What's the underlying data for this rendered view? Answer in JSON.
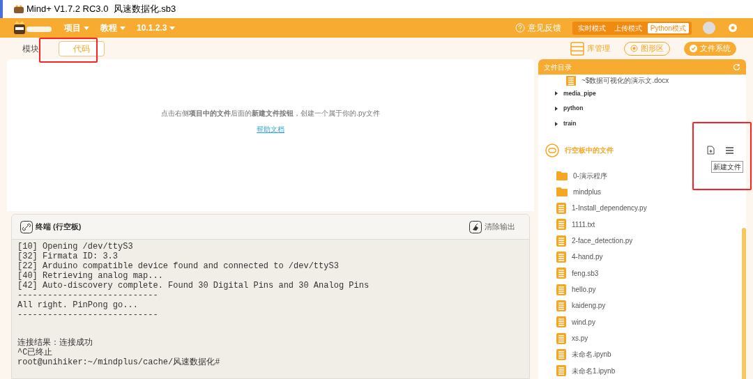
{
  "window": {
    "title": "Mind+ V1.7.2 RC3.0  风速数据化.sb3"
  },
  "menu": [
    {
      "label": "项目"
    },
    {
      "label": "教程"
    },
    {
      "label": "10.1.2.3"
    }
  ],
  "feedback": "意见反馈",
  "modes": [
    {
      "label": "实时模式",
      "selected": false
    },
    {
      "label": "上传模式",
      "selected": false
    },
    {
      "label": "Python模式",
      "selected": true
    }
  ],
  "tabs": [
    {
      "label": "模块",
      "selected": false
    },
    {
      "label": "代码",
      "selected": true
    }
  ],
  "toolbar": [
    {
      "label": "库管理",
      "kind": "plain"
    },
    {
      "label": "图形区",
      "kind": "outline"
    },
    {
      "label": "文件系统",
      "kind": "filled"
    }
  ],
  "editor": {
    "hint": "点击右侧**项目中的文件**后面的**新建文件按钮**，创建一个属于你的.py文件",
    "link": "帮助文档"
  },
  "terminal": {
    "title": "终端 (行空板)",
    "clear": "清除输出",
    "lines": [
      "[10] Opening /dev/ttyS3",
      "[32] Firmata ID: 3.3",
      "[22] Arduino compatible device found and connected to /dev/ttyS3",
      "[40] Retrieving analog map...",
      "[42] Auto-discovery complete. Found 30 Digital Pins and 30 Analog Pins",
      "----------------------------",
      "All right. PinPong go...",
      "----------------------------"
    ],
    "lines_after_gap": [
      "连接结果：连接成功",
      "^C已终止",
      "root@unihiker:~/mindplus/cache/风速数据化#"
    ]
  },
  "file_panel": {
    "title": "文件目录",
    "tree": [
      {
        "name": "~$数据可视化的演示文.docx",
        "kind": "file"
      },
      {
        "name": "media_pipe",
        "kind": "folder"
      },
      {
        "name": "python",
        "kind": "folder"
      },
      {
        "name": "train",
        "kind": "folder"
      }
    ],
    "board_section": "行空板中的文件",
    "tooltip": "新建文件",
    "board_files": [
      {
        "name": "0-演示程序",
        "kind": "folder"
      },
      {
        "name": "mindplus",
        "kind": "folder"
      },
      {
        "name": "1-Install_dependency.py",
        "kind": "file"
      },
      {
        "name": "1111.txt",
        "kind": "file"
      },
      {
        "name": "2-face_detection.py",
        "kind": "file"
      },
      {
        "name": "4-hand.py",
        "kind": "file"
      },
      {
        "name": "feng.sb3",
        "kind": "file"
      },
      {
        "name": "hello.py",
        "kind": "file"
      },
      {
        "name": "kaideng.py",
        "kind": "file"
      },
      {
        "name": "wind.py",
        "kind": "file"
      },
      {
        "name": "xs.py",
        "kind": "file"
      },
      {
        "name": "未命名.ipynb",
        "kind": "file"
      },
      {
        "name": "未命名1.ipynb",
        "kind": "file"
      }
    ]
  }
}
